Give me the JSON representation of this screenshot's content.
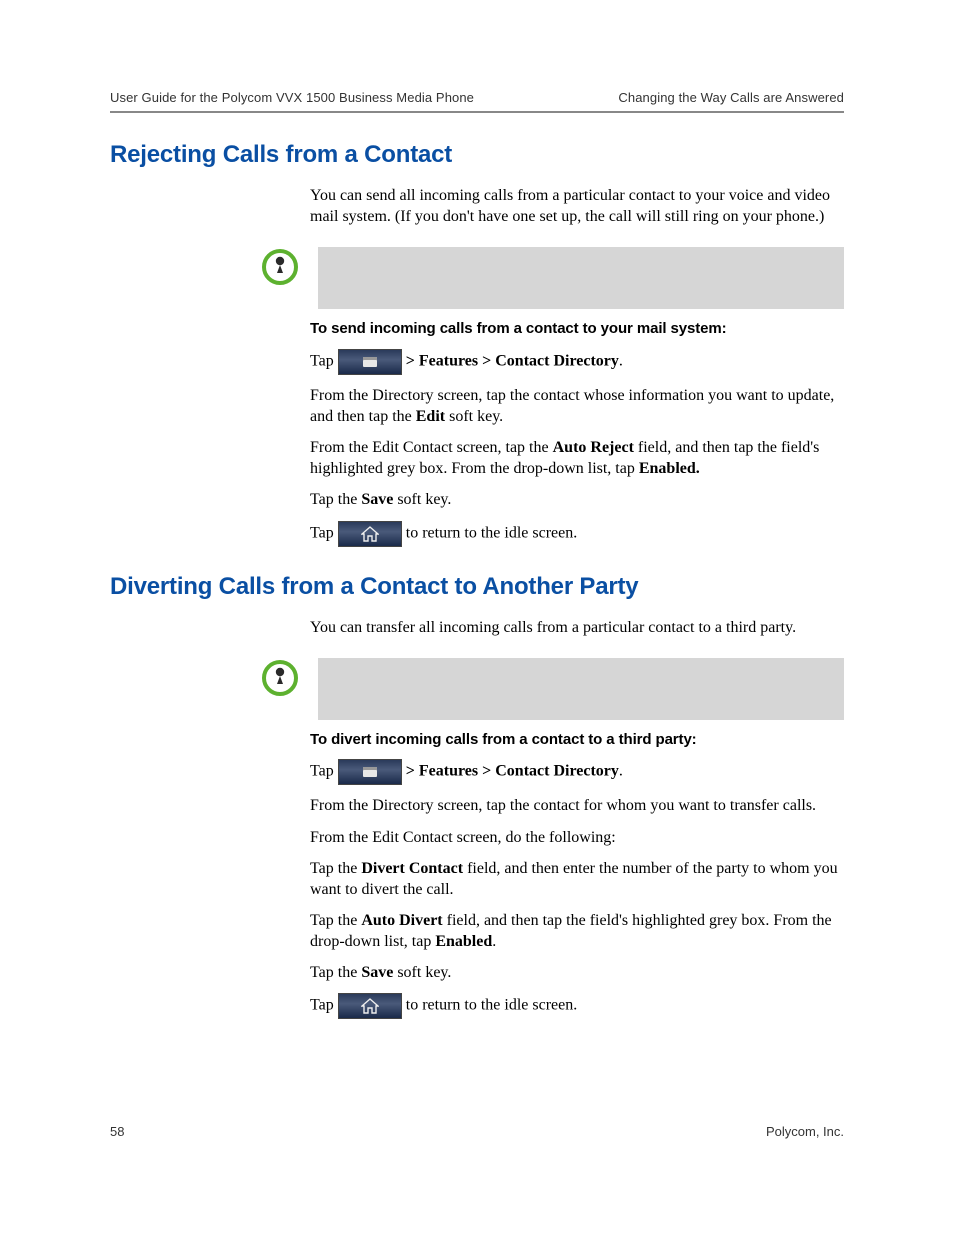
{
  "header": {
    "left": "User Guide for the Polycom VVX 1500 Business Media Phone",
    "right": "Changing the Way Calls are Answered"
  },
  "s1": {
    "title": "Rejecting Calls from a Contact",
    "intro": "You can send all incoming calls from a particular contact to your voice and video mail system. (If you don't have one set up, the call will still ring on your phone.)",
    "subhead": "To send incoming calls from a contact to your mail system:",
    "step1_a": "Tap ",
    "step1_b": "  > Features > Contact Directory",
    "step1_c": ".",
    "step2_a": "From the Directory screen, tap the contact whose information you want to update, and then tap the ",
    "step2_b": "Edit",
    "step2_c": " soft key.",
    "step3_a": "From the Edit Contact screen, tap the ",
    "step3_b": "Auto Reject",
    "step3_c": " field, and then tap the field's highlighted grey box. From the drop-down list, tap ",
    "step3_d": "Enabled.",
    "step4_a": "Tap the ",
    "step4_b": "Save",
    "step4_c": " soft key.",
    "step5_a": "Tap ",
    "step5_b": "  to return to the idle screen."
  },
  "s2": {
    "title": "Diverting Calls from a Contact to Another Party",
    "intro": "You can transfer all incoming calls from a particular contact to a third party.",
    "subhead": "To divert incoming calls from a contact to a third party:",
    "step1_a": "Tap ",
    "step1_b": "  > Features > Contact Directory",
    "step1_c": ".",
    "step2": "From the Directory screen, tap the contact for whom you want to transfer calls.",
    "step3": "From the Edit Contact screen, do the following:",
    "step3a_a": "Tap the ",
    "step3a_b": "Divert Contact",
    "step3a_c": " field, and then enter the number of the party to whom you want to divert the call.",
    "step3b_a": "Tap the ",
    "step3b_b": "Auto Divert",
    "step3b_c": " field, and then tap the field's highlighted grey box. From the drop-down list, tap ",
    "step3b_d": "Enabled",
    "step3b_e": ".",
    "step4_a": "Tap the ",
    "step4_b": "Save",
    "step4_c": " soft key.",
    "step5_a": "Tap ",
    "step5_b": "  to return to the idle screen."
  },
  "footer": {
    "page": "58",
    "company": "Polycom, Inc."
  }
}
